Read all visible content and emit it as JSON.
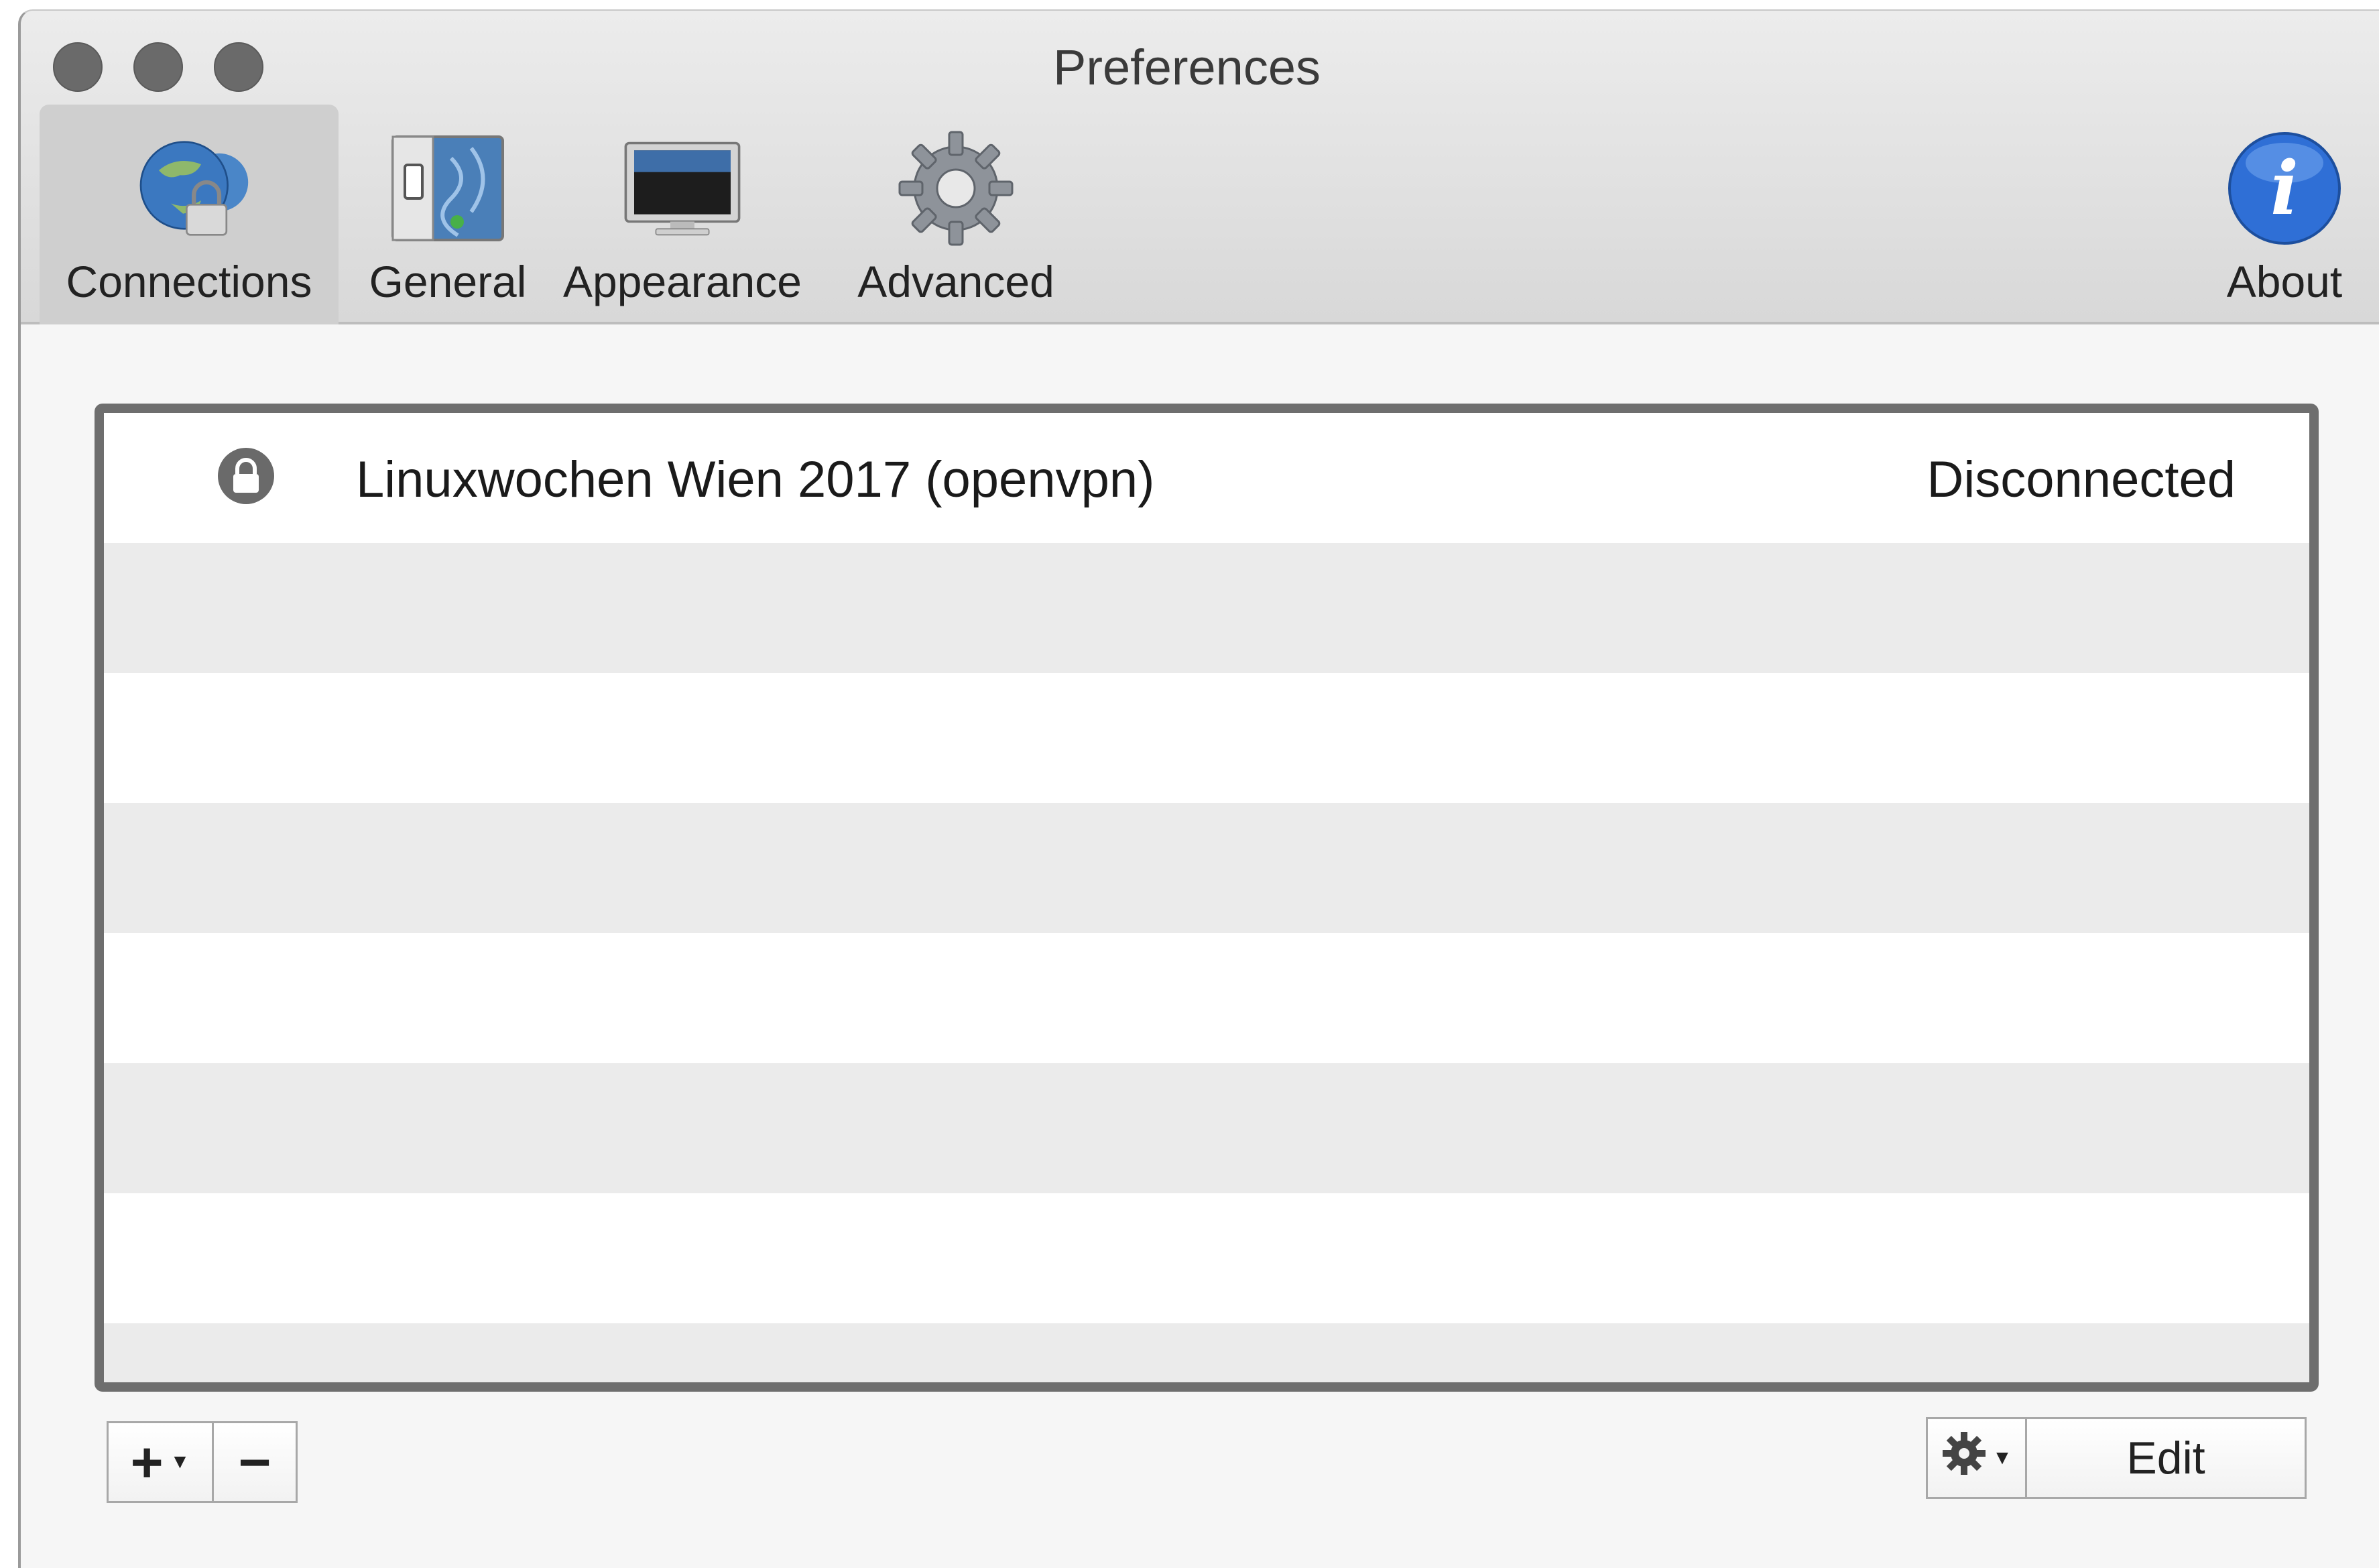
{
  "window": {
    "title": "Preferences"
  },
  "toolbar": {
    "items": [
      {
        "label": "Connections",
        "icon": "globe-lock-icon",
        "selected": true
      },
      {
        "label": "General",
        "icon": "switch-panel-icon",
        "selected": false
      },
      {
        "label": "Appearance",
        "icon": "monitor-icon",
        "selected": false
      },
      {
        "label": "Advanced",
        "icon": "gear-icon",
        "selected": false
      },
      {
        "label": "About",
        "icon": "info-icon",
        "selected": false
      }
    ]
  },
  "connections": {
    "rows": [
      {
        "name": "Linuxwochen Wien 2017 (openvpn)",
        "status": "Disconnected",
        "icon": "lock-icon"
      }
    ]
  },
  "bottom": {
    "add_symbol": "+",
    "remove_symbol": "−",
    "edit_label": "Edit"
  },
  "colors": {
    "about_blue": "#2f6fd6",
    "row_alt": "#ebebeb",
    "list_border": "#6e6e6e"
  }
}
